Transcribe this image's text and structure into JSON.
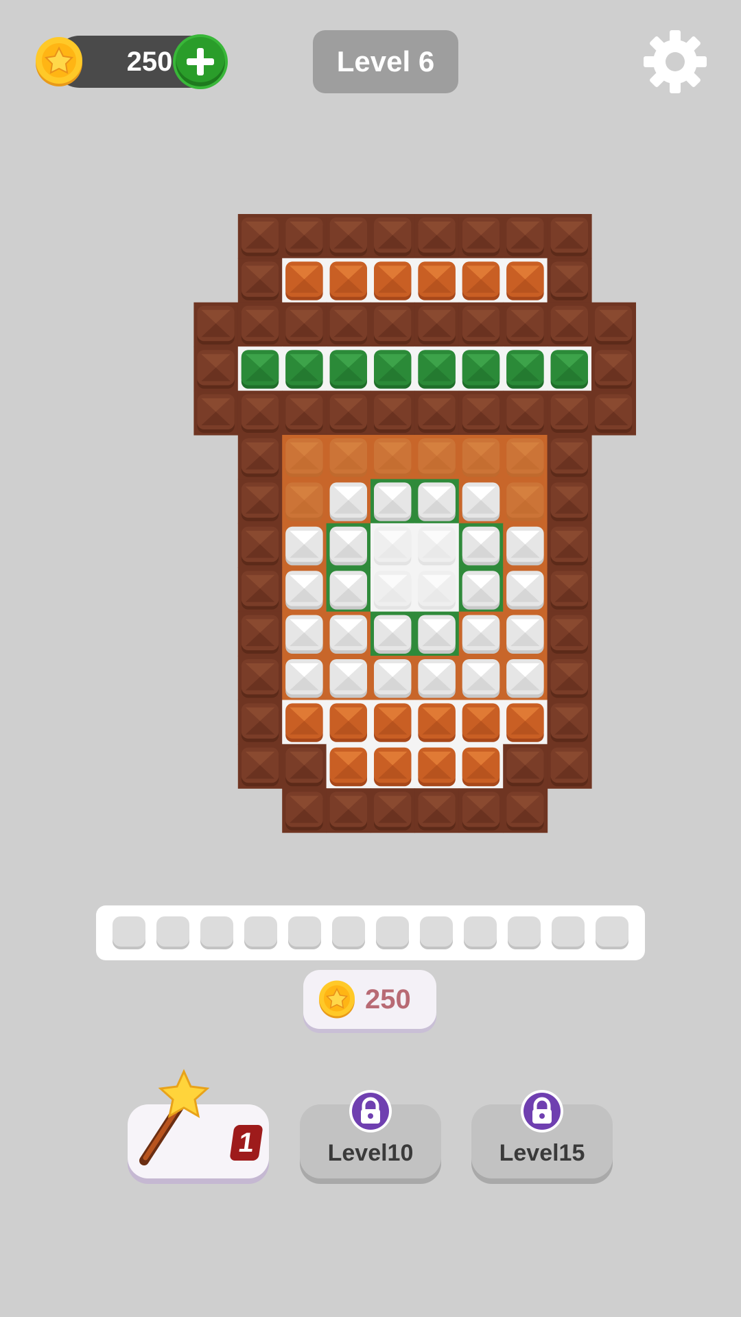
{
  "header": {
    "coins": "250",
    "level_title": "Level 6"
  },
  "icons": {
    "coin": "coin-icon",
    "add": "plus-icon",
    "settings": "gear-icon",
    "lock": "lock-icon",
    "wand": "magic-wand-icon"
  },
  "colors": {
    "brown": "#7c3f27",
    "orange": "#c45f22",
    "orange_bg": "#c8662a",
    "green": "#2f8a3a",
    "white_block": "#f2f2f2",
    "background": "#cfcfcf"
  },
  "board": {
    "legend": {
      "B": "brown block",
      "O": "orange block",
      "o": "faded orange block",
      "G": "green block",
      "W": "white block",
      "w": "faded white block",
      ".": "empty"
    },
    "rows": [
      "..BBBBBBBB..",
      "..BOOOOOOB..",
      ".BBBBBBBBBB.",
      ".BGGGGGGGGB.",
      ".BBBBBBBBBB.",
      "..BooooooB..",
      "..BoWWWWoB..",
      "..BWWwwWWB..",
      "..BWWwwWWB..",
      "..BWWWWWWB..",
      "..BWWWWWWB..",
      "..BOOOOOOB..",
      "..BBOOOOBB..",
      "...BBBBBB..."
    ]
  },
  "tray": {
    "slots": 12
  },
  "cost": {
    "value": "250"
  },
  "boosters": [
    {
      "type": "wand",
      "count": "1",
      "locked": false
    },
    {
      "type": "locked",
      "label": "Level10",
      "locked": true
    },
    {
      "type": "locked",
      "label": "Level15",
      "locked": true
    }
  ]
}
